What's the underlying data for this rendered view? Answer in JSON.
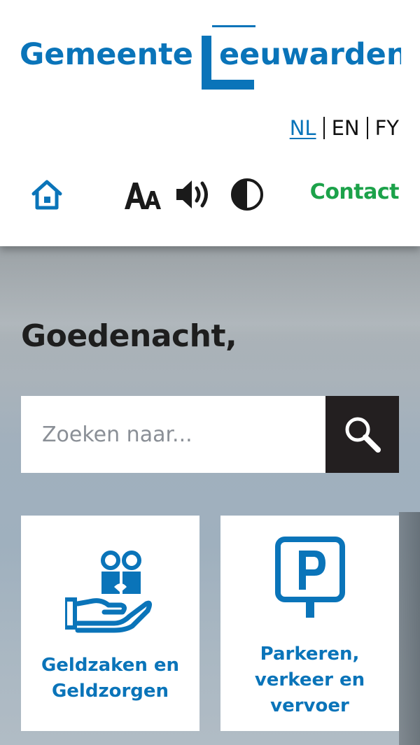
{
  "logo": {
    "word1": "Gemeente",
    "word2_initial": "L",
    "word2_rest": "eeuwarden"
  },
  "languages": [
    {
      "code": "NL",
      "active": true
    },
    {
      "code": "EN",
      "active": false
    },
    {
      "code": "FY",
      "active": false
    }
  ],
  "toolbar": {
    "icons": [
      "home-icon",
      "text-size-icon",
      "read-aloud-icon",
      "contrast-icon"
    ],
    "contact_label": "Contact"
  },
  "hero": {
    "greeting": "Goedenacht,"
  },
  "search": {
    "placeholder": "Zoeken naar...",
    "value": ""
  },
  "tiles": [
    {
      "label_line1": "Geldzaken en",
      "label_line2": "Geldzorgen",
      "icon": "money-care-icon"
    },
    {
      "label_line1": "Parkeren,",
      "label_line2": "verkeer en",
      "label_line3": "vervoer",
      "icon": "parking-icon"
    }
  ],
  "colors": {
    "brand_blue": "#0a74b9",
    "contact_green": "#1ca24a",
    "search_button": "#231f20",
    "text_dark": "#1e1e1e"
  }
}
